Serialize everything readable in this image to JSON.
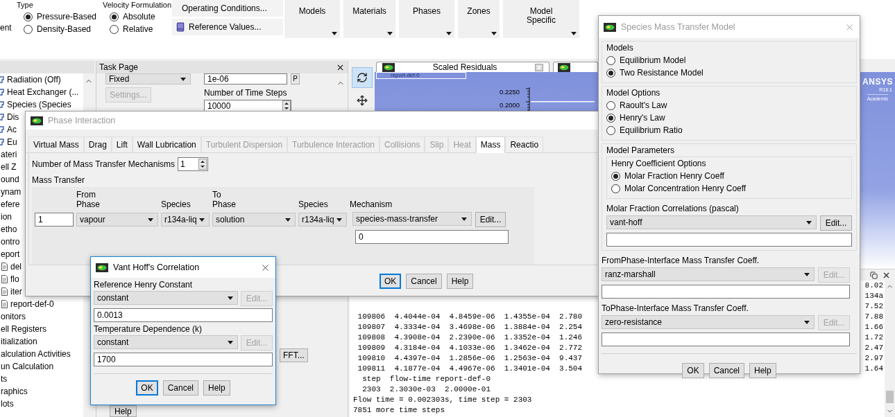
{
  "ribbon": {
    "cut_label": "ent",
    "type_group": {
      "title": "Type",
      "options": [
        {
          "label": "Pressure-Based",
          "selected": true
        },
        {
          "label": "Density-Based",
          "selected": false
        }
      ]
    },
    "velocity_group": {
      "title": "Velocity Formulation",
      "options": [
        {
          "label": "Absolute",
          "selected": true
        },
        {
          "label": "Relative",
          "selected": false
        }
      ]
    },
    "operating_conditions": "Operating Conditions...",
    "reference_values": "Reference Values...",
    "menus": [
      "Models",
      "Materials",
      "Phases",
      "Zones",
      "Model Specific"
    ]
  },
  "tree": {
    "items": [
      {
        "label": "Radiation (Off)",
        "kind": "model"
      },
      {
        "label": "Heat Exchanger (...",
        "kind": "model"
      },
      {
        "label": "Species (Species",
        "kind": "model"
      },
      {
        "label": "Dis",
        "kind": "model"
      },
      {
        "label": "Ac",
        "kind": "model"
      },
      {
        "label": "Eu",
        "kind": "model"
      },
      {
        "label": "ateri",
        "kind": "plain"
      },
      {
        "label": "ell Z",
        "kind": "plain"
      },
      {
        "label": "ound",
        "kind": "plain"
      },
      {
        "label": "ynam",
        "kind": "plain"
      },
      {
        "label": "efere",
        "kind": "plain"
      },
      {
        "label": "ion",
        "kind": "plain"
      },
      {
        "label": "etho",
        "kind": "plain"
      },
      {
        "label": "ontro",
        "kind": "plain"
      },
      {
        "label": "eport",
        "kind": "plain"
      },
      {
        "label": "del",
        "kind": "file"
      },
      {
        "label": "flo",
        "kind": "file"
      },
      {
        "label": "iter",
        "kind": "file"
      },
      {
        "label": "report-def-0",
        "kind": "file"
      },
      {
        "label": "onitors",
        "kind": "plain"
      },
      {
        "label": "ell Registers",
        "kind": "plain"
      },
      {
        "label": "itialization",
        "kind": "plain"
      },
      {
        "label": "alculation Activities",
        "kind": "plain"
      },
      {
        "label": "un Calculation",
        "kind": "plain"
      },
      {
        "label": "ts",
        "kind": "plain"
      },
      {
        "label": "raphics",
        "kind": "plain"
      },
      {
        "label": "lots",
        "kind": "plain"
      }
    ]
  },
  "task_page": {
    "title": "Task Page",
    "method": "Fixed",
    "settings": {
      "label": "Settings...",
      "disabled": true
    },
    "tolerance": "1e-06",
    "p_button": "P",
    "time_steps_label": "Number of Time Steps",
    "time_steps": "10000",
    "fft_button": "FFT...",
    "help_button": "Help"
  },
  "graphics": {
    "tab_title": "Scaled Residuals",
    "legend": "report-def-0",
    "yticks": [
      "0.2250",
      "0.2000"
    ],
    "logo": {
      "brand": "ANSYS",
      "version": "R18.1",
      "edition": "Academic"
    }
  },
  "console": {
    "lines": [
      {
        "tail": "8.02"
      },
      {
        "tail": "134a"
      },
      {
        "tail": "7.52"
      },
      {
        "text": " 109806  4.4044e-04  4.8459e-06  1.4355e-04  2.780",
        "tail": "7.88"
      },
      {
        "text": " 109807  4.3334e-04  3.4698e-06  1.3884e-04  2.254",
        "tail": "1.66"
      },
      {
        "text": " 109808  4.3908e-04  2.2390e-06  1.3352e-04  1.246",
        "tail": "1.72"
      },
      {
        "text": " 109809  4.3184e-04  4.1033e-06  1.3462e-04  2.772",
        "tail": "2.47"
      },
      {
        "text": " 109810  4.4397e-04  1.2856e-06  1.2563e-04  9.437",
        "tail": "2.97"
      },
      {
        "text": " 109811  4.1877e-04  4.4967e-06  1.3401e-04  3.504",
        "tail": "1.64"
      },
      {
        "text": "  step  flow-time report-def-0"
      },
      {
        "text": "  2303  2.3030e-03  2.0000e-01"
      },
      {
        "text": "Flow time = 0.002303s, time step = 2303"
      },
      {
        "text": "7851 more time steps"
      }
    ]
  },
  "phase_interaction": {
    "title": "Phase Interaction",
    "active": false,
    "tabs": [
      {
        "label": "Virtual Mass",
        "selected": false,
        "disabled": false
      },
      {
        "label": "Drag",
        "selected": false,
        "disabled": false
      },
      {
        "label": "Lift",
        "selected": false,
        "disabled": false
      },
      {
        "label": "Wall Lubrication",
        "selected": false,
        "disabled": false
      },
      {
        "label": "Turbulent Dispersion",
        "selected": false,
        "disabled": true
      },
      {
        "label": "Turbulence Interaction",
        "selected": false,
        "disabled": true
      },
      {
        "label": "Collisions",
        "selected": false,
        "disabled": true
      },
      {
        "label": "Slip",
        "selected": false,
        "disabled": true
      },
      {
        "label": "Heat",
        "selected": false,
        "disabled": true
      },
      {
        "label": "Mass",
        "selected": true,
        "disabled": false
      },
      {
        "label": "Reactio",
        "selected": false,
        "disabled": false
      }
    ],
    "mechanisms_label": "Number of Mass Transfer Mechanisms",
    "mechanisms": "1",
    "section": "Mass Transfer",
    "headers": [
      "From Phase",
      "Species",
      "To Phase",
      "Species",
      "Mechanism"
    ],
    "row": {
      "index": "1",
      "from_phase": "vapour",
      "from_species": "r134a-liq",
      "to_phase": "solution",
      "to_species": "r134a-liq",
      "mechanism": "species-mass-transfer",
      "edit": {
        "label": "Edit...",
        "disabled": false
      },
      "value": "0"
    },
    "buttons": [
      {
        "label": "OK",
        "focused": true
      },
      {
        "label": "Cancel",
        "focused": false
      },
      {
        "label": "Help",
        "focused": false
      }
    ]
  },
  "vant_hoff": {
    "title": "Vant Hoff's Correlation",
    "active": true,
    "fields": [
      {
        "label": "Reference Henry Constant",
        "method": "constant",
        "edit": {
          "label": "Edit...",
          "disabled": true
        },
        "value": "0.0013"
      },
      {
        "label": "Temperature Dependence (k)",
        "method": "constant",
        "edit": {
          "label": "Edit...",
          "disabled": true
        },
        "value": "1700"
      }
    ],
    "buttons": [
      {
        "label": "OK",
        "focused": true
      },
      {
        "label": "Cancel",
        "focused": false
      },
      {
        "label": "Help",
        "focused": false
      }
    ]
  },
  "species_mass_transfer": {
    "title": "Species Mass Transfer Model",
    "active": false,
    "models": {
      "title": "Models",
      "options": [
        {
          "label": "Equilibrium Model",
          "selected": false
        },
        {
          "label": "Two Resistance Model",
          "selected": true
        }
      ]
    },
    "model_options": {
      "title": "Model Options",
      "options": [
        {
          "label": "Raoult's Law",
          "selected": false
        },
        {
          "label": "Henry's Law",
          "selected": true
        },
        {
          "label": "Equilibrium Ratio",
          "selected": false
        }
      ]
    },
    "model_parameters": {
      "title": "Model Parameters",
      "henry": {
        "title": "Henry Coefficient Options",
        "options": [
          {
            "label": "Molar Fraction Henry Coeff",
            "selected": true
          },
          {
            "label": "Molar Concentration Henry Coeff",
            "selected": false
          }
        ]
      },
      "correlation": {
        "label": "Molar Fraction Correlations (pascal)",
        "method": "vant-hoff",
        "edit": {
          "label": "Edit...",
          "disabled": false
        }
      }
    },
    "coefficients": [
      {
        "label": "FromPhase-Interface Mass Transfer Coeff.",
        "method": "ranz-marshall",
        "edit": {
          "label": "Edit...",
          "disabled": true
        }
      },
      {
        "label": "ToPhase-Interface Mass Transfer Coeff.",
        "method": "zero-resistance",
        "edit": {
          "label": "Edit...",
          "disabled": true
        }
      }
    ],
    "buttons": [
      {
        "label": "OK",
        "focused": false
      },
      {
        "label": "Cancel",
        "focused": false
      },
      {
        "label": "Help",
        "focused": false
      }
    ]
  }
}
